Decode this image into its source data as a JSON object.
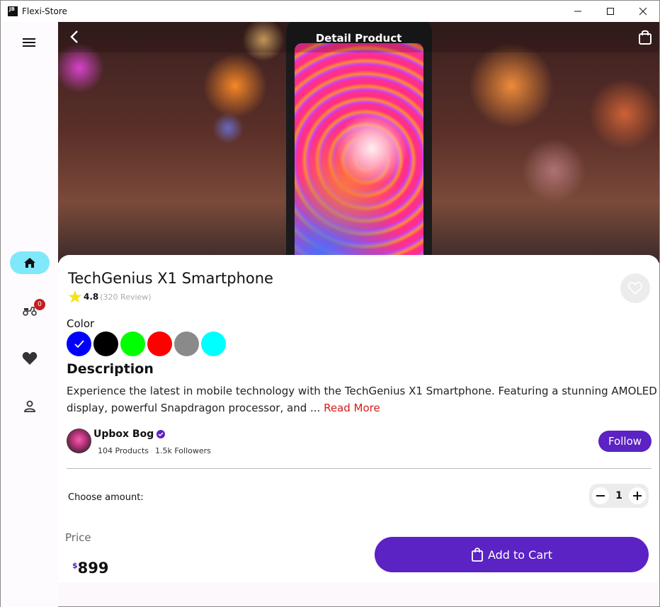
{
  "window": {
    "title": "Flexi-Store",
    "icon_text": "JB"
  },
  "nav": {
    "items": [
      {
        "name": "home",
        "active": true
      },
      {
        "name": "delivery",
        "badge": "0"
      },
      {
        "name": "favorites"
      },
      {
        "name": "profile"
      }
    ]
  },
  "header": {
    "title": "Detail Product"
  },
  "product": {
    "name": "TechGenius X1 Smartphone",
    "rating": "4.8",
    "reviews": "(320 Review)",
    "color_label": "Color",
    "colors": [
      "#0000ff",
      "#000000",
      "#00ff00",
      "#ff0000",
      "#8a8a8a",
      "#00ffff"
    ],
    "selected_color": "#0000ff",
    "description_title": "Description",
    "description": "Experience the latest in mobile technology with the TechGenius X1 Smartphone. Featuring a stunning AMOLED display, powerful Snapdragon processor, and ...",
    "read_more": "Read More"
  },
  "seller": {
    "name": "Upbox Bog",
    "products": "104 Products",
    "followers": "1.5k Followers",
    "follow_label": "Follow"
  },
  "quantity": {
    "label": "Choose amount:",
    "value": "1"
  },
  "price": {
    "label": "Price",
    "currency": "$",
    "value": "899"
  },
  "cart": {
    "label": "Add to Cart"
  },
  "colors": {
    "accent": "#5b22c4",
    "rail_active": "#7fe8fb",
    "badge": "#c81d1d",
    "link": "#d61c1c"
  }
}
